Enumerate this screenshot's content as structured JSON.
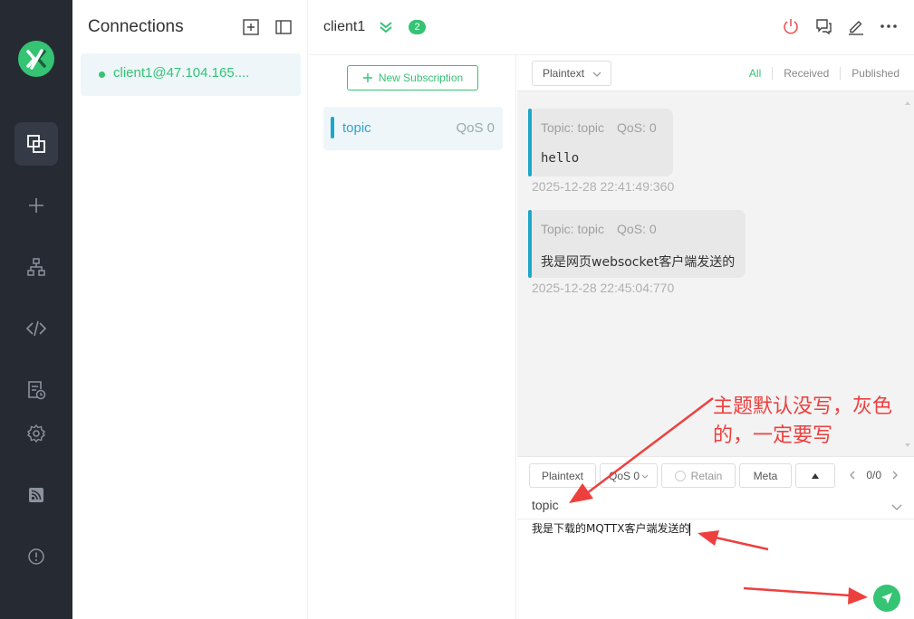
{
  "colors": {
    "brand": "#35c374",
    "rail_bg": "#262b33",
    "topic_accent": "#1ea7c7",
    "annotation": "#ee3f3f"
  },
  "rail": {
    "items": [
      {
        "icon": "connections-icon",
        "active": true
      },
      {
        "icon": "plus-icon"
      },
      {
        "icon": "sitemap-icon"
      },
      {
        "icon": "code-icon"
      },
      {
        "icon": "log-icon"
      },
      {
        "icon": "gear-icon"
      },
      {
        "icon": "rss-icon"
      },
      {
        "icon": "info-icon"
      }
    ]
  },
  "connections": {
    "title": "Connections",
    "items": [
      {
        "name": "client1@47.104.165....",
        "status": "connected"
      }
    ]
  },
  "header": {
    "client_name": "client1",
    "badge_count": "2"
  },
  "subscriptions": {
    "new_label": "New Subscription",
    "items": [
      {
        "topic": "topic",
        "qos": "QoS 0"
      }
    ]
  },
  "messages": {
    "format": "Plaintext",
    "filters": [
      "All",
      "Received",
      "Published"
    ],
    "list": [
      {
        "topic_label": "Topic: topic",
        "qos_label": "QoS: 0",
        "payload": "hello",
        "time": "2025-12-28 22:41:49:360"
      },
      {
        "topic_label": "Topic: topic",
        "qos_label": "QoS: 0",
        "payload": "我是网页websocket客户端发送的",
        "time": "2025-12-28 22:45:04:770"
      }
    ]
  },
  "publish": {
    "format": "Plaintext",
    "qos": "QoS 0",
    "retain_label": "Retain",
    "meta_label": "Meta",
    "page_indicator": "0/0",
    "topic": "topic",
    "payload": "我是下载的MQTTX客户端发送的"
  },
  "annotation": {
    "line1": "主题默认没写，灰色",
    "line2": "的，一定要写"
  }
}
